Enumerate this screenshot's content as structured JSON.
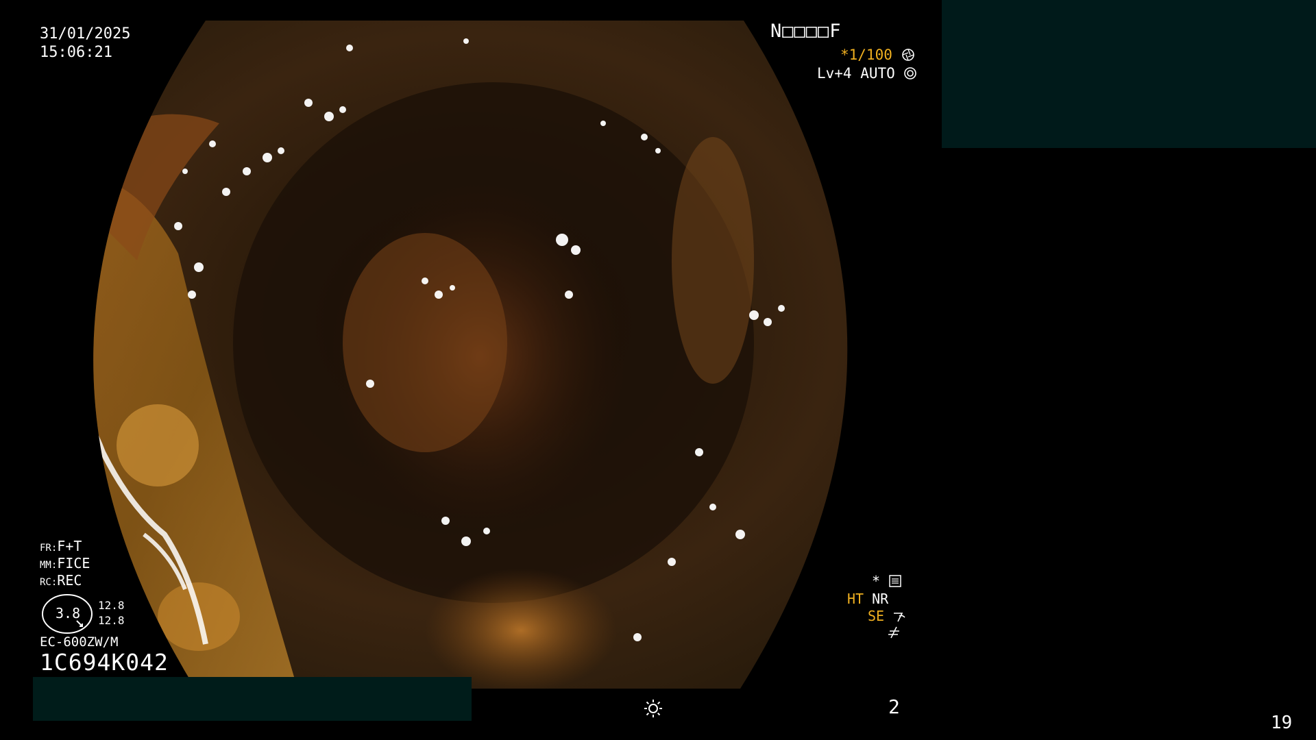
{
  "overlay": {
    "date": "31/01/2025",
    "time": "15:06:21",
    "patient_code": "N□□□□F",
    "shutter": "*1/100",
    "shutter_icon": "aperture-icon",
    "level": "Lv+4",
    "auto_mode": "AUTO",
    "auto_icon": "iris-icon",
    "fr_label": "FR",
    "fr_value": "F+T",
    "mm_label": "MM",
    "mm_value": "FICE",
    "rc_label": "RC",
    "rc_value": "REC",
    "zoom_value": "3.8",
    "zoom_a": "12.8",
    "zoom_b": "12.8",
    "scope_model": "EC-600ZW/M",
    "serial": "1C694K042",
    "star": "*",
    "settings_icon": "settings-panel-icon",
    "ht": "HT",
    "nr": "NR",
    "se": "SE",
    "frame_number": "2",
    "page_number": "19"
  },
  "colors": {
    "mask": "#001a1a",
    "highlight": "#f0b020",
    "text": "#ffffff"
  }
}
